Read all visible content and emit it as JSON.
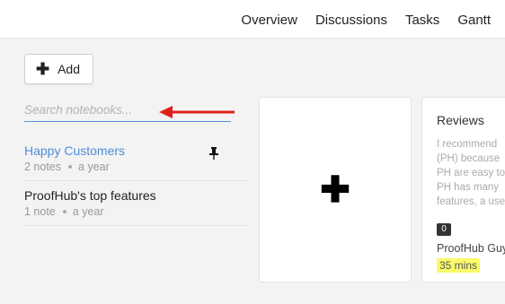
{
  "topnav": {
    "tabs": [
      "Overview",
      "Discussions",
      "Tasks",
      "Gantt"
    ]
  },
  "toolbar": {
    "add_label": "Add"
  },
  "search": {
    "placeholder": "Search notebooks..."
  },
  "notebooks": [
    {
      "title": "Happy Customers",
      "count": "2 notes",
      "updated": "a year",
      "pinned": true,
      "active": true
    },
    {
      "title": "ProofHub's top features",
      "count": "1 note",
      "updated": "a year",
      "pinned": false,
      "active": false
    }
  ],
  "card": {
    "title": "Reviews",
    "excerpt": [
      "I recommend",
      "(PH) because",
      "PH are easy to",
      "PH has many",
      "features, a use"
    ],
    "comments": "0",
    "author": "ProofHub Guy",
    "time": "35 mins"
  },
  "colors": {
    "accent": "#4d8ddb",
    "arrow": "#e0201b",
    "highlight": "#fafa6a"
  },
  "icons": {
    "pin": "pin-icon",
    "add": "plus-icon",
    "annotation": "arrow-left-icon"
  }
}
